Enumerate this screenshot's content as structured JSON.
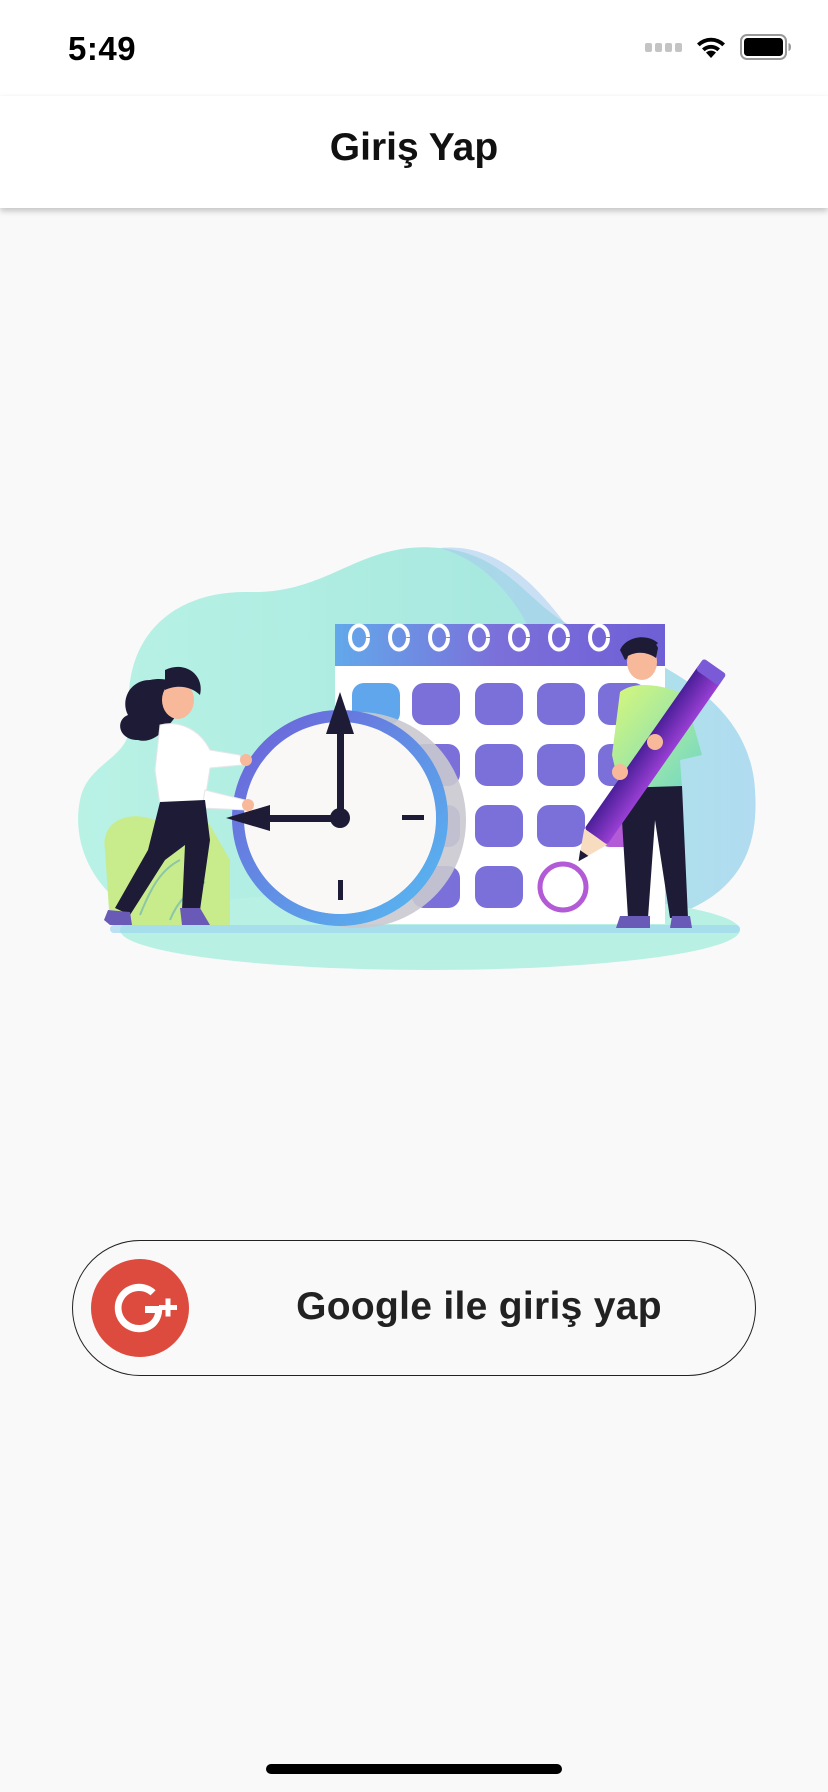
{
  "status_bar": {
    "time": "5:49",
    "icons": [
      "signal-icon",
      "wifi-icon",
      "battery-icon"
    ]
  },
  "nav": {
    "title": "Giriş Yap"
  },
  "illustration": {
    "icon": "calendar-clock-illustration",
    "colors": {
      "blob": "#a8efe1",
      "calendar_cell": "#7b6fd9",
      "clock_ring": "#6a5ad6",
      "figure_dark": "#1d1b36"
    }
  },
  "login": {
    "google_label": "Google ile giriş yap",
    "google_icon": "google-plus-icon",
    "google_color": "#dd4b3e"
  }
}
